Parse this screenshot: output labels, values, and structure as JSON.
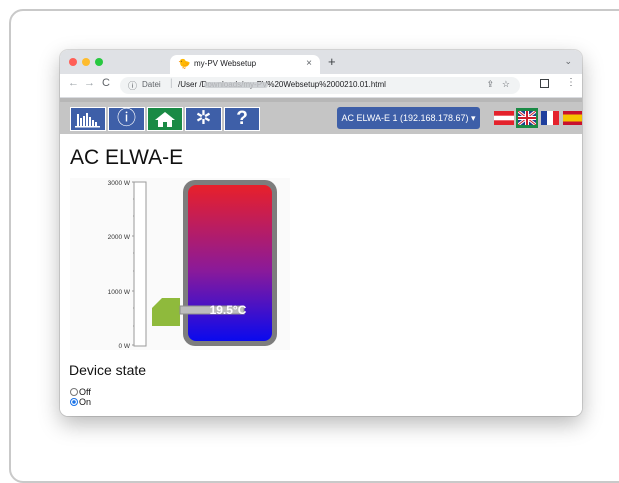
{
  "browser": {
    "tab_title": "my-PV Websetup",
    "tab_favicon": "🐤",
    "tab_close": "×",
    "new_tab": "+",
    "tab_menu": "⌄",
    "nav_back": "←",
    "nav_forward": "→",
    "nav_reload": "C",
    "omnibox_info": "ⓘ",
    "omnibox_scheme": "Datei",
    "omnibox_separator": "|",
    "url": "/User                  /Downloads/my-PV%20Websetup%2000210.01.html",
    "share_icon": "⇪",
    "star_icon": "☆",
    "menu_icon": "⋮"
  },
  "navbar": {
    "buttons": [
      {
        "name": "chart-button",
        "icon": "bar-chart-icon",
        "active": false
      },
      {
        "name": "info-button",
        "icon": "info-icon",
        "label": "ⓘ",
        "active": false
      },
      {
        "name": "home-button",
        "icon": "home-icon",
        "active": true
      },
      {
        "name": "settings-button",
        "icon": "gear-icon",
        "label": "✲",
        "active": false
      },
      {
        "name": "help-button",
        "icon": "help-icon",
        "label": "?",
        "active": false
      }
    ],
    "device_select": "AC ELWA-E 1 (192.168.178.67) ▾",
    "languages": [
      "de-at",
      "en",
      "fr",
      "es"
    ]
  },
  "main": {
    "title": "AC ELWA-E",
    "power_axis": {
      "ticks": [
        "3000 W",
        "2000 W",
        "1000 W",
        "0 W"
      ]
    },
    "temperature": "19.5°C",
    "colors": {
      "hot": "#e8202a",
      "cold": "#1010e6",
      "tank_border": "#7d7d7d",
      "heater": "#8fba3c"
    },
    "device_state": {
      "heading": "Device state",
      "options": [
        {
          "label": "Off",
          "checked": false
        },
        {
          "label": "On",
          "checked": true
        }
      ]
    }
  }
}
